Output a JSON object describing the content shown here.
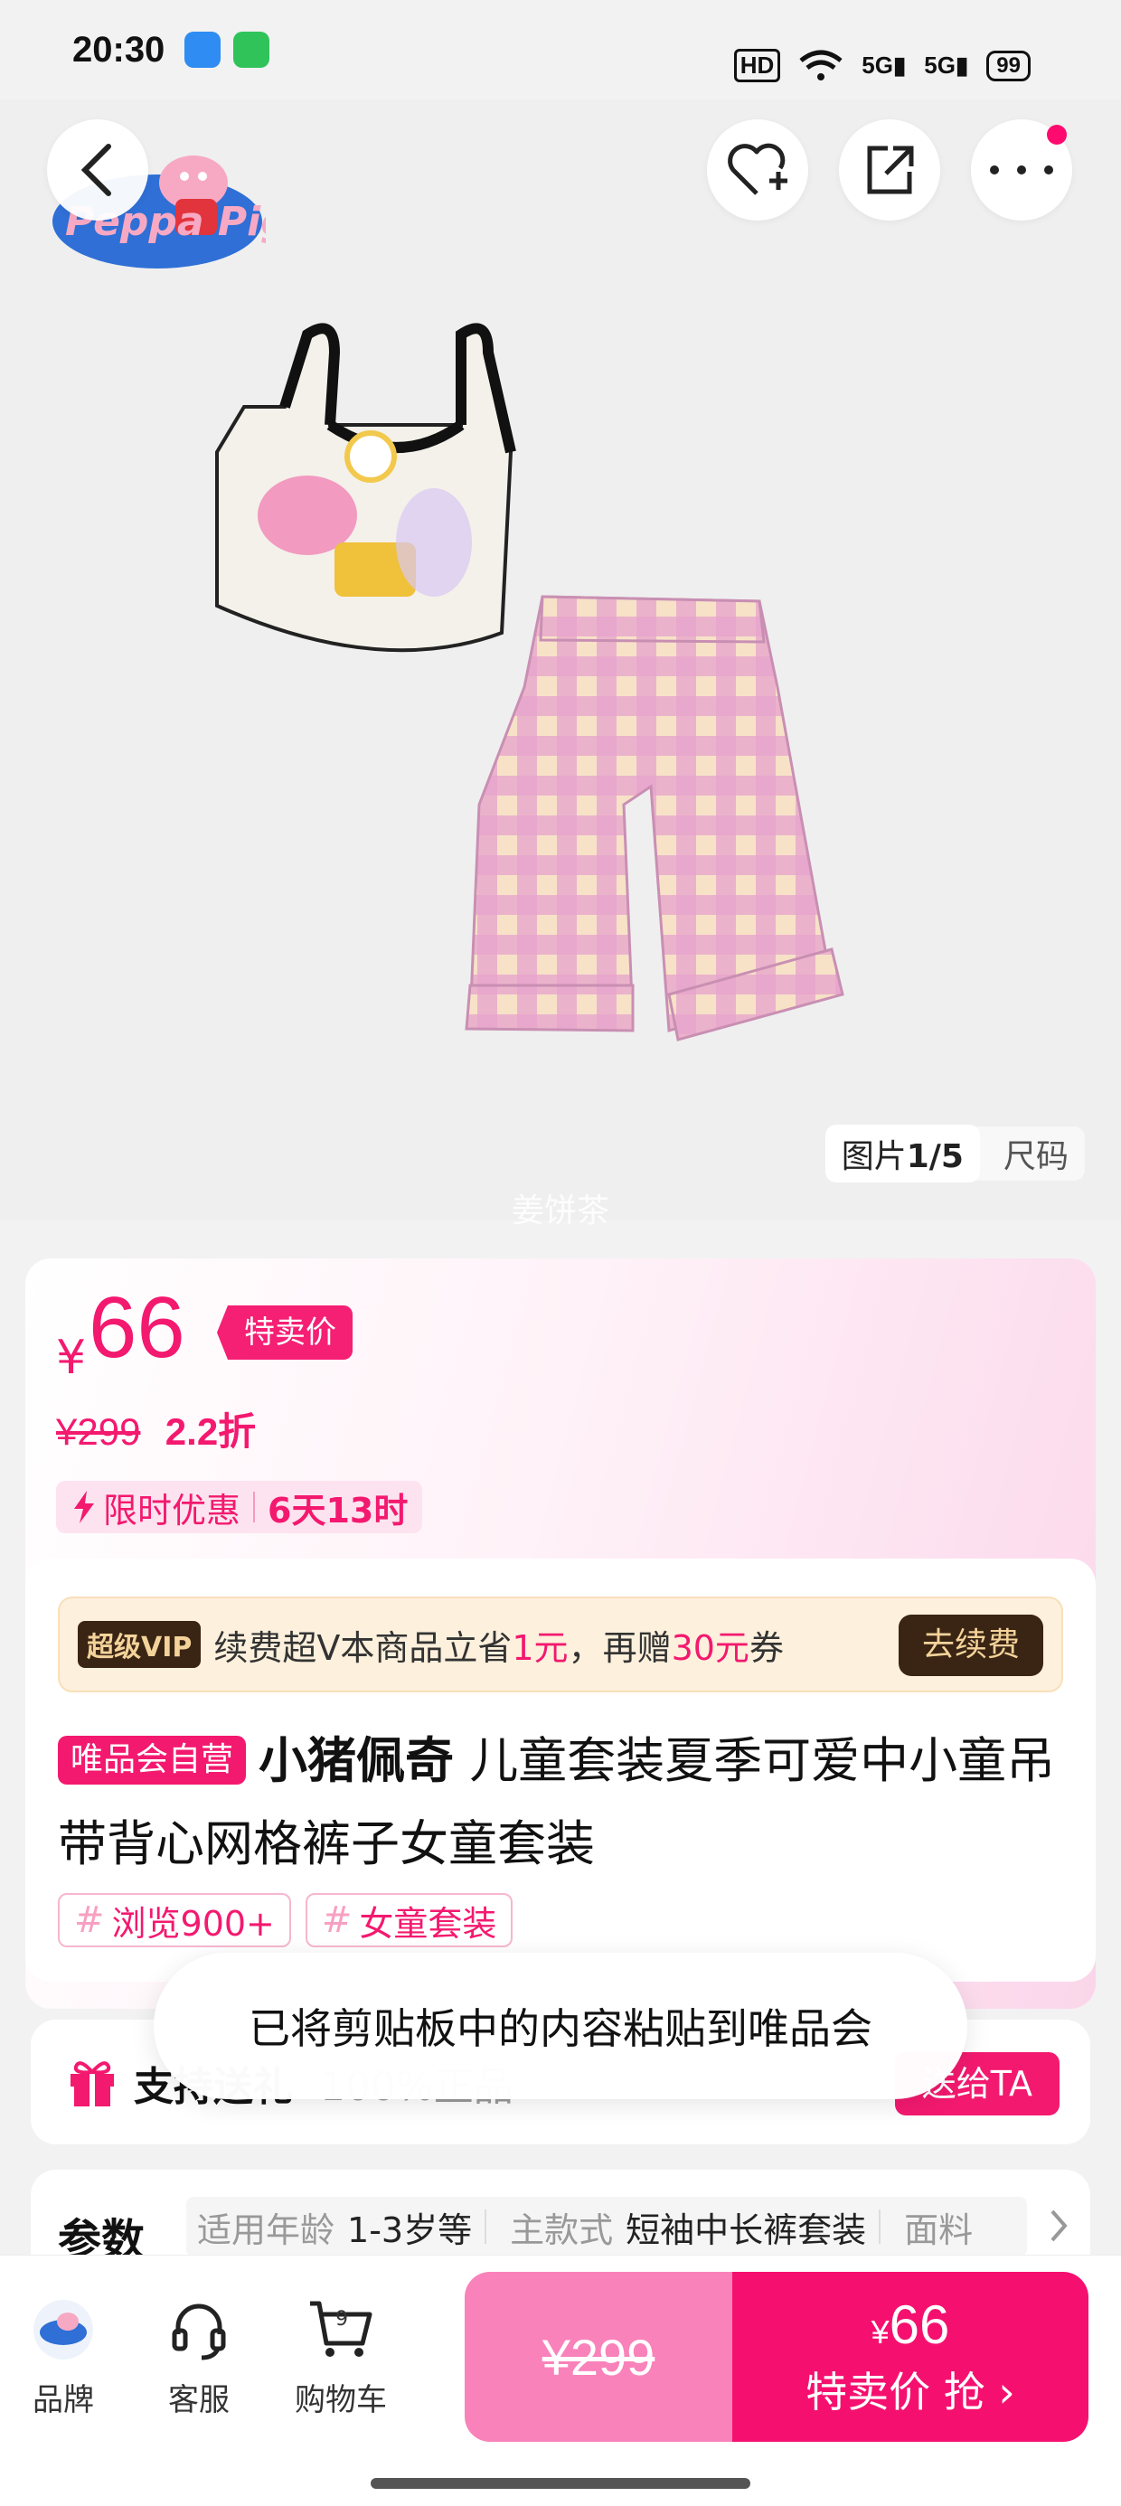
{
  "status": {
    "time": "20:30",
    "hd": "HD",
    "net1": "5G",
    "net2": "5G",
    "battery": "99"
  },
  "product_image": {
    "counter_label": "图片",
    "counter_value": "1/5",
    "size_tab": "尺码",
    "watermark": "姜饼茶",
    "brand_logo_text": "Peppa Pig"
  },
  "price": {
    "currency": "¥",
    "sale": "66",
    "tag": "特卖价",
    "original": "¥299",
    "discount": "2.2折",
    "limited_label": "限时优惠",
    "limited_time": "6天13时"
  },
  "vip": {
    "tag": "超级VIP",
    "text_a": "续费超V本商品立省",
    "hl_a": "1元",
    "text_b": "，再赠",
    "hl_b": "30元",
    "text_c": "券",
    "button": "去续费"
  },
  "product": {
    "self_tag": "唯品会自营",
    "brand": "小猪佩奇",
    "title": "儿童套装夏季可爱中小童吊带背心网格裤子女童套装",
    "tags": [
      "浏览900+",
      "女童套装"
    ]
  },
  "gift": {
    "text": "支持送礼",
    "sub": "100%正品",
    "button": "送给TA"
  },
  "toast": "已将剪贴板中的内容粘贴到唯品会",
  "params": {
    "label": "参数",
    "items": [
      {
        "k": "适用年龄",
        "v": "1-3岁等"
      },
      {
        "k": "主款式",
        "v": "短袖中长裤套装"
      },
      {
        "k": "面料",
        "v": ""
      }
    ]
  },
  "bottom": {
    "brand": "品牌",
    "service": "客服",
    "cart": "购物车",
    "cart_count": "9",
    "orig_price": "¥299",
    "buy_currency": "¥",
    "buy_price": "66",
    "buy_label": "特卖价 抢"
  },
  "colors": {
    "accent": "#f3196f",
    "vip_dark": "#3a2414",
    "vip_gold": "#f3d39a"
  }
}
